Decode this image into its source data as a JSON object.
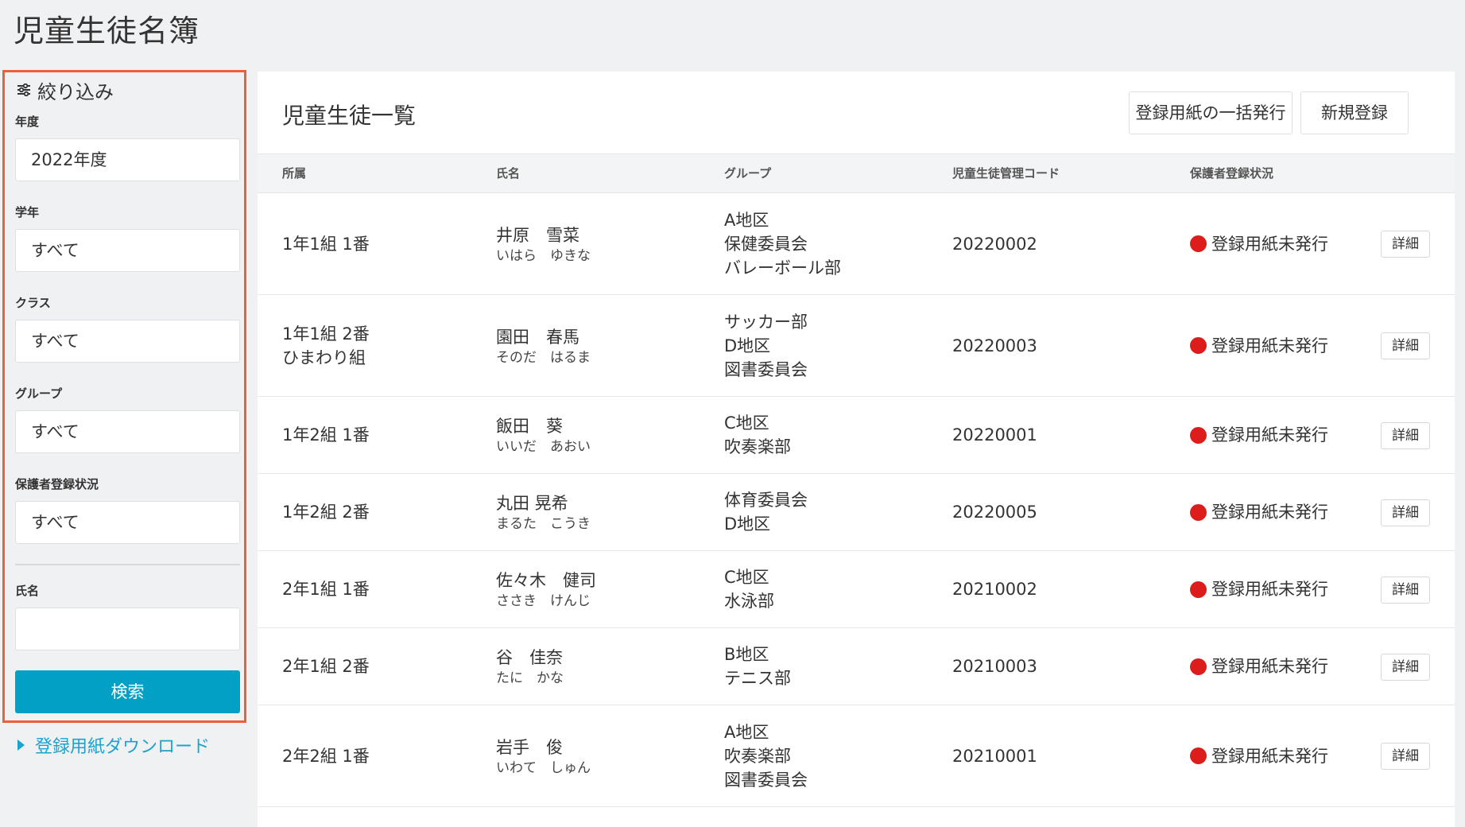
{
  "page": {
    "title": "児童生徒名簿"
  },
  "filter": {
    "heading": "絞り込み",
    "year": {
      "label": "年度",
      "value": "2022年度"
    },
    "grade": {
      "label": "学年",
      "value": "すべて"
    },
    "class": {
      "label": "クラス",
      "value": "すべて"
    },
    "group": {
      "label": "グループ",
      "value": "すべて"
    },
    "guardian_status": {
      "label": "保護者登録状況",
      "value": "すべて"
    },
    "name": {
      "label": "氏名",
      "value": ""
    },
    "search_button": "検索"
  },
  "download_link": "登録用紙ダウンロード",
  "main": {
    "title": "児童生徒一覧",
    "bulk_issue_button": "登録用紙の一括発行",
    "new_button": "新規登録"
  },
  "table": {
    "headers": {
      "affiliation": "所属",
      "name": "氏名",
      "group": "グループ",
      "code": "児童生徒管理コード",
      "guardian_status": "保護者登録状況"
    },
    "detail_label": "詳細",
    "status_color": "#dd1c1c",
    "rows": [
      {
        "affiliation": [
          "1年1組 1番"
        ],
        "name": "井原　雪菜",
        "kana": "いはら　ゆきな",
        "groups": [
          "A地区",
          "保健委員会",
          "バレーボール部"
        ],
        "code": "20220002",
        "status": "登録用紙未発行"
      },
      {
        "affiliation": [
          "1年1組 2番",
          "ひまわり組"
        ],
        "name": "園田　春馬",
        "kana": "そのだ　はるま",
        "groups": [
          "サッカー部",
          "D地区",
          "図書委員会"
        ],
        "code": "20220003",
        "status": "登録用紙未発行"
      },
      {
        "affiliation": [
          "1年2組 1番"
        ],
        "name": "飯田　葵",
        "kana": "いいだ　あおい",
        "groups": [
          "C地区",
          "吹奏楽部"
        ],
        "code": "20220001",
        "status": "登録用紙未発行"
      },
      {
        "affiliation": [
          "1年2組 2番"
        ],
        "name": "丸田 晃希",
        "kana": "まるた　こうき",
        "groups": [
          "体育委員会",
          "D地区"
        ],
        "code": "20220005",
        "status": "登録用紙未発行"
      },
      {
        "affiliation": [
          "2年1組 1番"
        ],
        "name": "佐々木　健司",
        "kana": "ささき　けんじ",
        "groups": [
          "C地区",
          "水泳部"
        ],
        "code": "20210002",
        "status": "登録用紙未発行"
      },
      {
        "affiliation": [
          "2年1組 2番"
        ],
        "name": "谷　佳奈",
        "kana": "たに　かな",
        "groups": [
          "B地区",
          "テニス部"
        ],
        "code": "20210003",
        "status": "登録用紙未発行"
      },
      {
        "affiliation": [
          "2年2組 1番"
        ],
        "name": "岩手　俊",
        "kana": "いわて　しゅん",
        "groups": [
          "A地区",
          "吹奏楽部",
          "図書委員会"
        ],
        "code": "20210001",
        "status": "登録用紙未発行"
      }
    ]
  }
}
